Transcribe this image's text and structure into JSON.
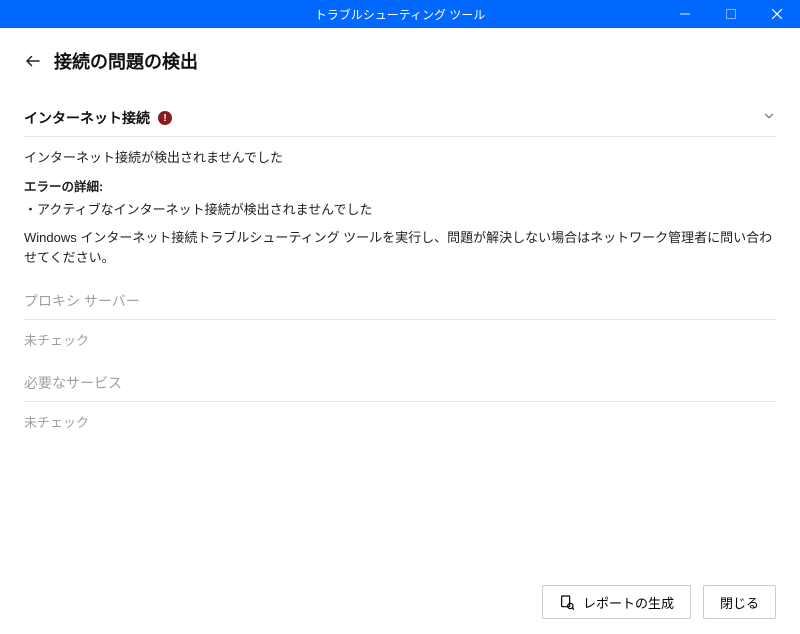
{
  "titlebar": {
    "title": "トラブルシューティング ツール"
  },
  "page": {
    "title": "接続の問題の検出"
  },
  "sections": {
    "internet": {
      "title": "インターネット接続",
      "status_text": "インターネット接続が検出されませんでした",
      "error_label": "エラーの詳細:",
      "bullet1": "・アクティブなインターネット接続が検出されませんでした",
      "help": "Windows インターネット接続トラブルシューティング ツールを実行し、問題が解決しない場合はネットワーク管理者に問い合わせてください。"
    },
    "proxy": {
      "title": "プロキシ サーバー",
      "status": "未チェック"
    },
    "services": {
      "title": "必要なサービス",
      "status": "未チェック"
    }
  },
  "footer": {
    "report_label": "レポートの生成",
    "close_label": "閉じる"
  }
}
